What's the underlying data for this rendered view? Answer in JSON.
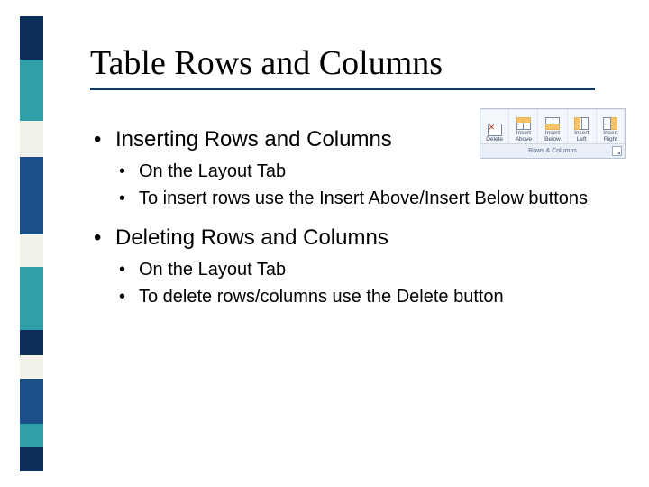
{
  "title": "Table Rows and Columns",
  "section1": {
    "heading": "Inserting Rows and Columns",
    "items": [
      "On the Layout Tab",
      "To insert rows use the Insert Above/Insert Below buttons"
    ]
  },
  "section2": {
    "heading": "Deleting Rows and Columns",
    "items": [
      "On the Layout Tab",
      "To delete rows/columns use the Delete button"
    ]
  },
  "ribbon": {
    "group_label": "Rows & Columns",
    "buttons": [
      {
        "label": "Delete"
      },
      {
        "label": "Insert\nAbove"
      },
      {
        "label": "Insert\nBelow"
      },
      {
        "label": "Insert\nLeft"
      },
      {
        "label": "Insert\nRight"
      }
    ]
  }
}
